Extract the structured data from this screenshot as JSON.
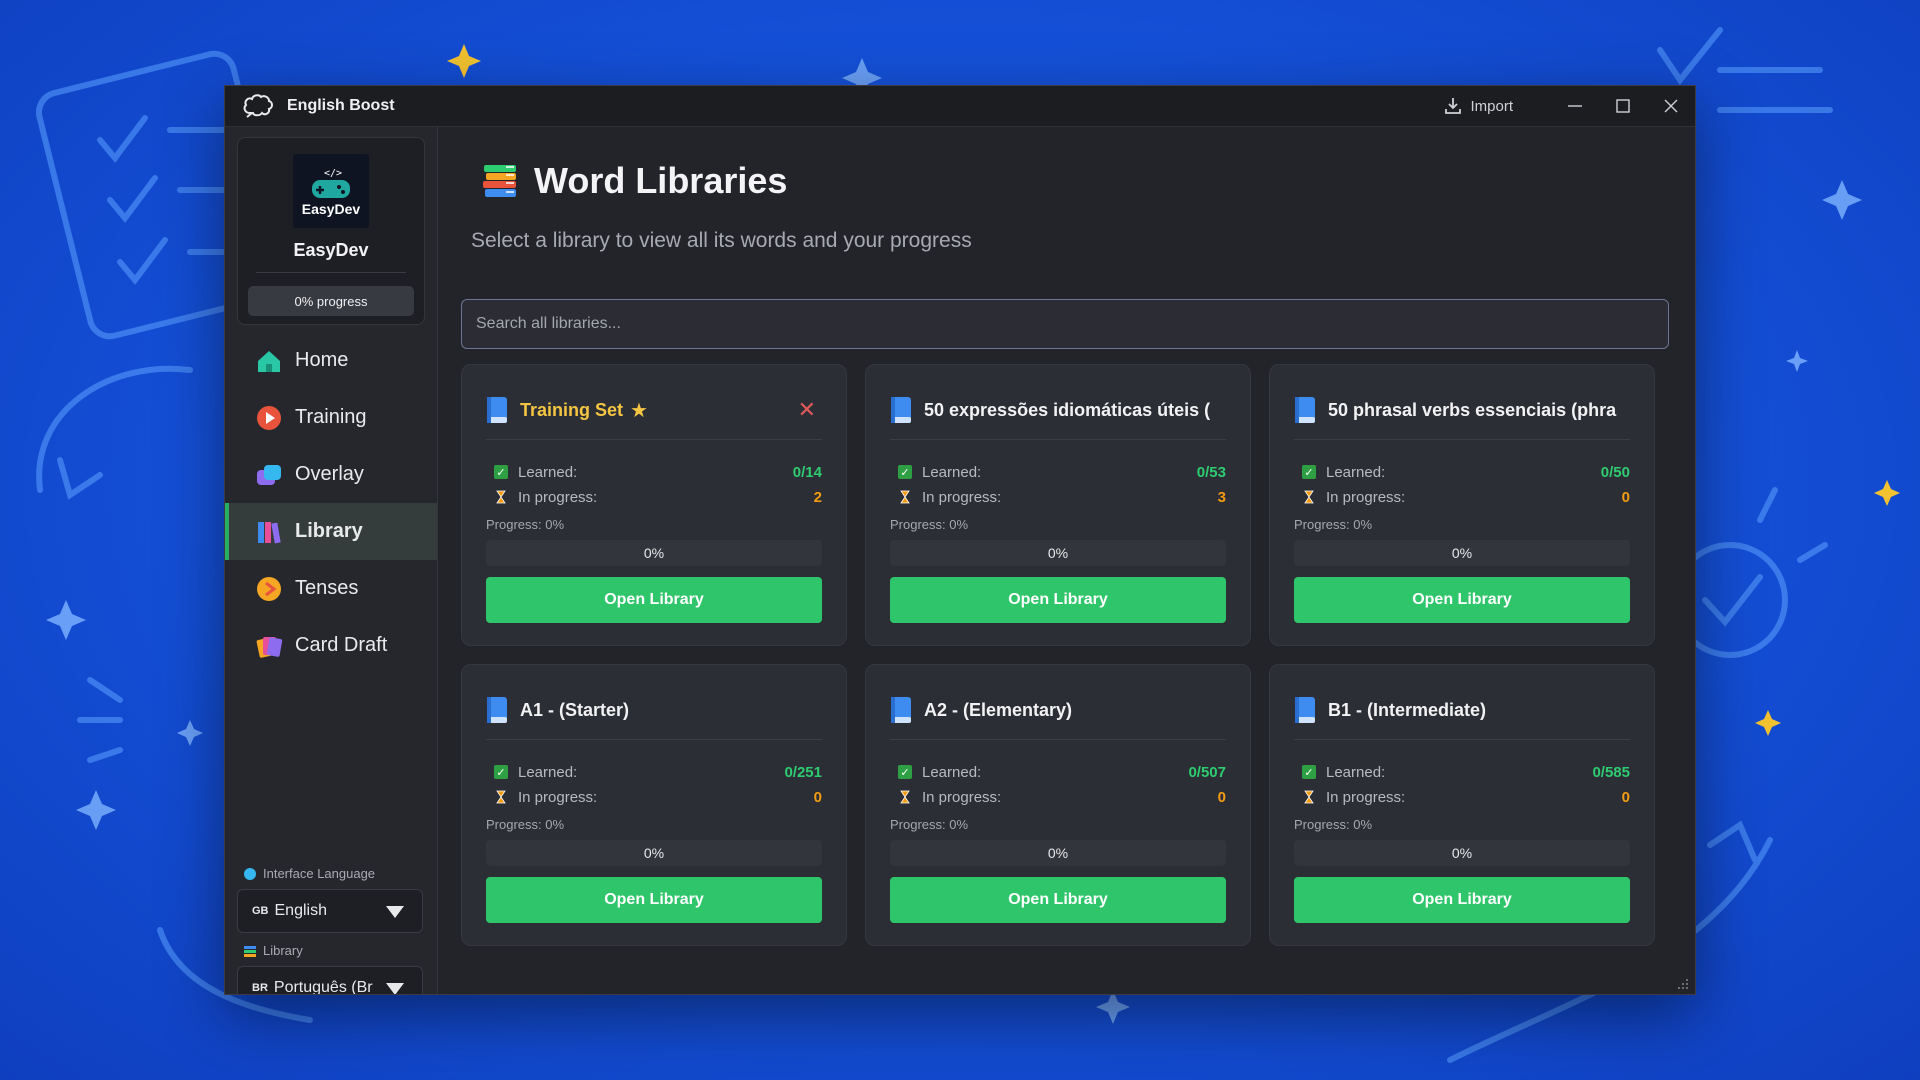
{
  "app": {
    "title": "English Boost",
    "import_label": "Import"
  },
  "profile": {
    "avatar_text": "EasyDev",
    "name": "EasyDev",
    "progress": "0% progress"
  },
  "nav": [
    {
      "label": "Home",
      "icon": "home-icon"
    },
    {
      "label": "Training",
      "icon": "training-icon"
    },
    {
      "label": "Overlay",
      "icon": "overlay-icon"
    },
    {
      "label": "Library",
      "icon": "library-icon",
      "active": true
    },
    {
      "label": "Tenses",
      "icon": "tenses-icon"
    },
    {
      "label": "Card Draft",
      "icon": "card-draft-icon"
    }
  ],
  "settings": {
    "interface_language_label": "Interface Language",
    "interface_language_flag": "GB",
    "interface_language_value": "English",
    "library_label": "Library",
    "library_flag": "BR",
    "library_value": "Português (Br"
  },
  "page": {
    "title": "Word Libraries",
    "subtitle": "Select a library to view all its words and your progress",
    "search_placeholder": "Search all libraries..."
  },
  "labels": {
    "learned": "Learned:",
    "in_progress": "In progress:",
    "open_button": "Open Library"
  },
  "libraries": [
    {
      "title": "Training Set",
      "starred": true,
      "removable": true,
      "learned": "0/14",
      "in_progress": "2",
      "progress_label": "Progress: 0%",
      "progress_value": "0%"
    },
    {
      "title": "50 expressões idiomáticas úteis (",
      "learned": "0/53",
      "in_progress": "3",
      "progress_label": "Progress: 0%",
      "progress_value": "0%"
    },
    {
      "title": "50 phrasal verbs essenciais (phra",
      "learned": "0/50",
      "in_progress": "0",
      "progress_label": "Progress: 0%",
      "progress_value": "0%"
    },
    {
      "title": "A1 - (Starter)",
      "learned": "0/251",
      "in_progress": "0",
      "progress_label": "Progress: 0%",
      "progress_value": "0%"
    },
    {
      "title": "A2 - (Elementary)",
      "learned": "0/507",
      "in_progress": "0",
      "progress_label": "Progress: 0%",
      "progress_value": "0%"
    },
    {
      "title": "B1 - (Intermediate)",
      "learned": "0/585",
      "in_progress": "0",
      "progress_label": "Progress: 0%",
      "progress_value": "0%"
    }
  ],
  "colors": {
    "accent": "#2fc56a",
    "gold": "#f4c542",
    "orange": "#f39c12",
    "danger": "#e05a5a"
  }
}
